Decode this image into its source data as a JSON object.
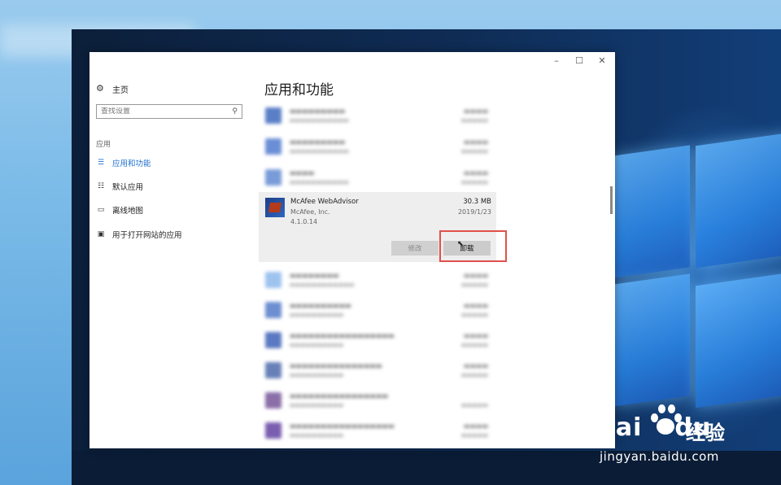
{
  "window": {
    "controls": {
      "minimize": "–",
      "maximize": "☐",
      "close": "✕"
    }
  },
  "sidebar": {
    "home_label": "主页",
    "home_icon": "gear-icon",
    "search_placeholder": "查找设置",
    "search_icon": "search-icon",
    "section_label": "应用",
    "items": [
      {
        "label": "应用和功能",
        "icon": "apps-features-icon",
        "active": true
      },
      {
        "label": "默认应用",
        "icon": "default-apps-icon",
        "active": false
      },
      {
        "label": "离线地图",
        "icon": "offline-maps-icon",
        "active": false
      },
      {
        "label": "用于打开网站的应用",
        "icon": "apps-for-websites-icon",
        "active": false
      }
    ],
    "accent_color": "#1f6fd0"
  },
  "main": {
    "title": "应用和功能",
    "selected_app": {
      "name": "McAfee WebAdvisor",
      "publisher": "McAfee, Inc.",
      "version": "4.1.0.14",
      "size": "30.3 MB",
      "date": "2019/1/23",
      "modify_label": "修改",
      "uninstall_label": "卸载"
    }
  },
  "highlight_color": "#e0504a",
  "watermark": {
    "brand": "Bai",
    "brand_suffix": "du",
    "cn": "经验",
    "url": "jingyan.baidu.com"
  }
}
